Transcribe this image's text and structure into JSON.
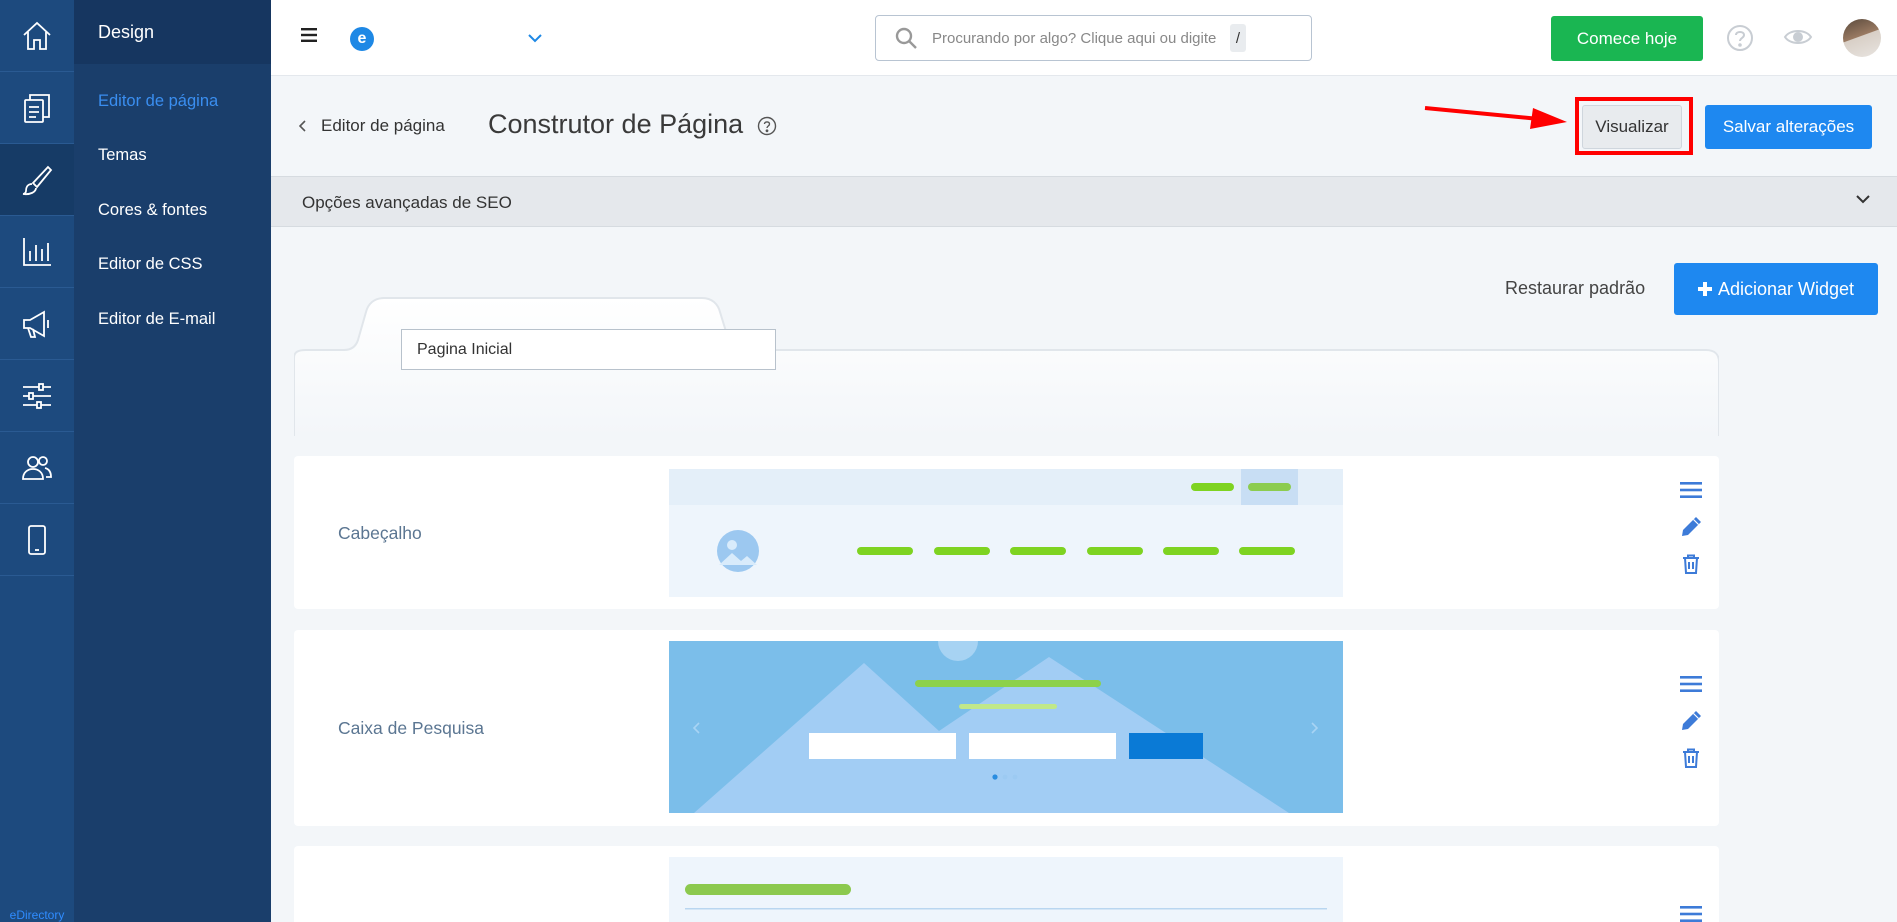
{
  "app": {
    "brand": "eDirectory"
  },
  "submenu": {
    "title": "Design",
    "items": [
      {
        "label": "Editor de página",
        "active": true
      },
      {
        "label": "Temas"
      },
      {
        "label": "Cores & fontes"
      },
      {
        "label": "Editor de CSS"
      },
      {
        "label": "Editor de E-mail"
      }
    ]
  },
  "topbar": {
    "logo_letter": "e",
    "search_placeholder": "Procurando por algo? Clique aqui ou digite",
    "search_shortcut": "/",
    "cta_label": "Comece hoje"
  },
  "header": {
    "back_label": "Editor de página",
    "title": "Construtor de Página",
    "preview_label": "Visualizar",
    "save_label": "Salvar alterações"
  },
  "seo": {
    "label": "Opções avançadas de SEO"
  },
  "toolbar": {
    "restore_label": "Restaurar padrão",
    "add_widget_label": "Adicionar Widget"
  },
  "page_tab": {
    "name_value": "Pagina Inicial"
  },
  "widgets": [
    {
      "label": "Cabeçalho"
    },
    {
      "label": "Caixa de Pesquisa"
    },
    {
      "label": ""
    }
  ],
  "colors": {
    "rail": "#1d4a7e",
    "submenu": "#1a3e6b",
    "accent_blue": "#1e88f0",
    "cta_green": "#1ab652",
    "highlight_red": "#ff0000",
    "active_link": "#3a8ef0"
  }
}
